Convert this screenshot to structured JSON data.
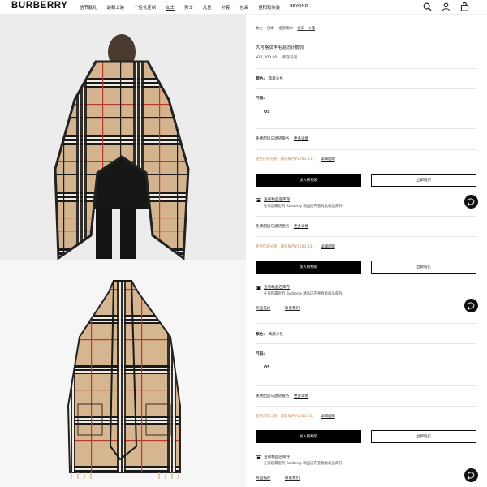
{
  "brand": {
    "logo": "BURBERRY"
  },
  "nav": [
    "信节献礼",
    "最新上装",
    "个性化定制",
    "女士",
    "男士",
    "儿童",
    "外套",
    "包袋",
    "懂稍和美装",
    "BEYOND"
  ],
  "nav_active": "女士",
  "header_icons": [
    "search-icon",
    "account-icon",
    "bag-icon"
  ],
  "images": [
    {
      "name": "product-image-back-view",
      "desc": "cape back view"
    },
    {
      "name": "product-image-flat-view",
      "desc": "cape flat view"
    }
  ],
  "product": {
    "breadcrumb": [
      "女士",
      "围巾",
      "全部围巾",
      "披肩 · 斗篷"
    ],
    "title": "大号格纹羊毛混纺针披肩",
    "price": "¥11,200.00",
    "stock": "库存有限"
  },
  "section1": {
    "color_label": "颜色:",
    "color_value": "典藏米色",
    "size_label": "尺码:",
    "size_option": "OS",
    "shipping_text": "免费配送与退货服务",
    "shipping_link": "更多详情",
    "installment_text": "使用花呗分期，最低每月¥1003.33。",
    "installment_link": "详细说明",
    "add_to_bag": "加入购物袋",
    "buy_now": "立即购买",
    "store_title": "查看精品店库存",
    "store_sub": "在离您最近的 Burberry 精品店内查找此商品库存。"
  },
  "section2": {
    "shipping_text": "免费配送与退货服务",
    "shipping_link": "更多详情",
    "installment_text": "使用花呗分期，最低每月¥1003.33。",
    "installment_link": "详细说明",
    "add_to_bag": "加入购物袋",
    "buy_now": "立即购买",
    "store_title": "查看精品店库存",
    "store_sub": "在离您最近的 Burberry 精品店内查找此商品库存。",
    "desc_link": "商品描述",
    "contact_link": "联系我们"
  },
  "section3": {
    "color_label": "颜色:",
    "color_value": "典藏米色",
    "size_label": "尺码:",
    "size_option": "OS",
    "shipping_text": "免费配送与退货服务",
    "shipping_link": "更多详情",
    "installment_text": "使用花呗分期，最低每月¥1003.33。",
    "installment_link": "详细说明",
    "add_to_bag": "加入购物袋",
    "buy_now": "立即购买",
    "store_title": "查看精品店库存",
    "store_sub": "在离您最近的 Burberry 精品店内查找此商品库存。",
    "desc_link": "商品描述",
    "contact_link": "联系我们"
  },
  "colors": {
    "accent": "#b98a55",
    "camel": "#d2b48c",
    "black": "#111111"
  }
}
